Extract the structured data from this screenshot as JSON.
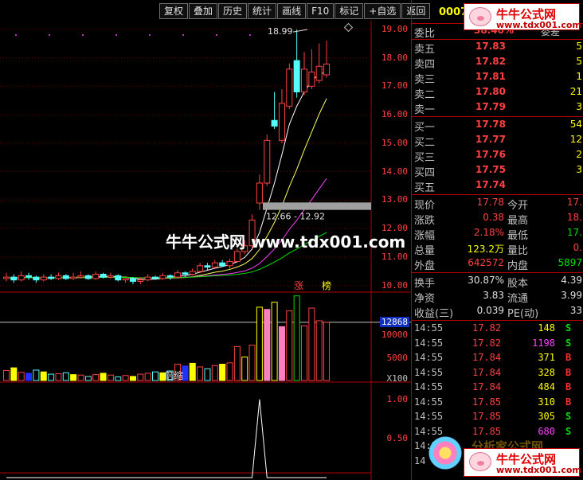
{
  "toolbar": {
    "buttons": [
      "复权",
      "叠加",
      "历史",
      "统计",
      "画线",
      "F10",
      "标记",
      "+自选",
      "返回"
    ]
  },
  "chart": {
    "price_axis": [
      "19.00",
      "18.00",
      "17.00",
      "16.00",
      "15.00",
      "14.00",
      "13.00",
      "12.00",
      "11.00",
      "10.00"
    ],
    "annotations": {
      "high_label": "18.99",
      "gap_label": "12.66 - 12.92",
      "limit_tag_1": "涨",
      "limit_tag_2": "榜"
    },
    "volume_axis": [
      "10000",
      "5000"
    ],
    "volume_current": "12868",
    "volume_unit": "X100",
    "volume_label": "倍缩",
    "indicator_axis": [
      "1.00",
      "0.50"
    ]
  },
  "watermark": {
    "main": "牛牛公式网 www.tdx001.com",
    "logo_title": "牛牛公式网",
    "logo_url": "www.tdx001.com",
    "faded_text": "分析家公式网"
  },
  "panel": {
    "code": "0007",
    "ratio_label": "委比",
    "ratio_value": "38.40%",
    "diff_label": "委差",
    "asks": [
      {
        "label": "卖五",
        "price": "17.83",
        "vol": "5"
      },
      {
        "label": "卖四",
        "price": "17.82",
        "vol": "5"
      },
      {
        "label": "卖三",
        "price": "17.81",
        "vol": "1"
      },
      {
        "label": "卖二",
        "price": "17.80",
        "vol": "21"
      },
      {
        "label": "卖一",
        "price": "17.79",
        "vol": "3"
      }
    ],
    "bids": [
      {
        "label": "买一",
        "price": "17.78",
        "vol": "54"
      },
      {
        "label": "买二",
        "price": "17.77",
        "vol": "12"
      },
      {
        "label": "买三",
        "price": "17.76",
        "vol": "2"
      },
      {
        "label": "买四",
        "price": "17.75",
        "vol": "3"
      },
      {
        "label": "买五",
        "price": "17.74",
        "vol": ""
      }
    ],
    "info": [
      {
        "l1": "现价",
        "v1": "17.78",
        "l2": "今开",
        "v2": "17."
      },
      {
        "l1": "涨跌",
        "v1": "0.38",
        "l2": "最高",
        "v2": "18."
      },
      {
        "l1": "涨幅",
        "v1": "2.18%",
        "l2": "最低",
        "v2": "17."
      },
      {
        "l1": "总量",
        "v1": "123.2万",
        "l2": "量比",
        "v2": "0."
      },
      {
        "l1": "外盘",
        "v1": "642572",
        "l2": "内盘",
        "v2": "5897"
      }
    ],
    "info2": [
      {
        "l1": "换手",
        "v1": "30.87%",
        "l2": "股本",
        "v2": "4.39"
      },
      {
        "l1": "净资",
        "v1": "3.83",
        "l2": "流通",
        "v2": "3.99"
      },
      {
        "l1": "收益(三)",
        "v1": "0.039",
        "l2": "PE(动)",
        "v2": "33"
      }
    ],
    "ticks": [
      {
        "time": "14:55",
        "price": "17.82",
        "vol": "148",
        "side": "S"
      },
      {
        "time": "14:55",
        "price": "17.82",
        "vol": "1198",
        "side": "S"
      },
      {
        "time": "14:55",
        "price": "17.84",
        "vol": "371",
        "side": "B"
      },
      {
        "time": "14:55",
        "price": "17.84",
        "vol": "328",
        "side": "B"
      },
      {
        "time": "14:55",
        "price": "17.84",
        "vol": "484",
        "side": "B"
      },
      {
        "time": "14:55",
        "price": "17.85",
        "vol": "310",
        "side": "B"
      },
      {
        "time": "14:55",
        "price": "17.85",
        "vol": "305",
        "side": "S"
      },
      {
        "time": "14:55",
        "price": "17.85",
        "vol": "680",
        "side": "S"
      },
      {
        "time": "14:55",
        "price": "",
        "vol": "",
        "side": ""
      },
      {
        "time": "14",
        "price": "",
        "vol": "",
        "side": ""
      }
    ]
  },
  "colors": {
    "up": "#ff4040",
    "down": "#54fcfc",
    "buy": "#ff3030",
    "sell": "#00e000",
    "yellow": "#ffff00",
    "magenta": "#ff40ff"
  },
  "chart_data": {
    "type": "candlestick",
    "price_range": [
      9.8,
      19.3
    ],
    "candles": [
      {
        "o": 10.25,
        "c": 10.3,
        "h": 10.45,
        "l": 10.15
      },
      {
        "o": 10.3,
        "c": 10.2,
        "h": 10.4,
        "l": 10.1
      },
      {
        "o": 10.2,
        "c": 10.35,
        "h": 10.5,
        "l": 10.15
      },
      {
        "o": 10.35,
        "c": 10.3,
        "h": 10.45,
        "l": 10.2
      },
      {
        "o": 10.3,
        "c": 10.2,
        "h": 10.35,
        "l": 10.1
      },
      {
        "o": 10.2,
        "c": 10.3,
        "h": 10.4,
        "l": 10.15
      },
      {
        "o": 10.3,
        "c": 10.25,
        "h": 10.4,
        "l": 10.2
      },
      {
        "o": 10.25,
        "c": 10.35,
        "h": 10.45,
        "l": 10.2
      },
      {
        "o": 10.35,
        "c": 10.25,
        "h": 10.4,
        "l": 10.2
      },
      {
        "o": 10.25,
        "c": 10.3,
        "h": 10.45,
        "l": 10.2
      },
      {
        "o": 10.3,
        "c": 10.35,
        "h": 10.5,
        "l": 10.25
      },
      {
        "o": 10.35,
        "c": 10.25,
        "h": 10.4,
        "l": 10.2
      },
      {
        "o": 10.25,
        "c": 10.4,
        "h": 10.5,
        "l": 10.2
      },
      {
        "o": 10.4,
        "c": 10.3,
        "h": 10.45,
        "l": 10.25
      },
      {
        "o": 10.3,
        "c": 10.35,
        "h": 10.45,
        "l": 10.25
      },
      {
        "o": 10.35,
        "c": 10.2,
        "h": 10.4,
        "l": 10.15
      },
      {
        "o": 10.2,
        "c": 10.25,
        "h": 10.3,
        "l": 10.1
      },
      {
        "o": 10.25,
        "c": 10.15,
        "h": 10.3,
        "l": 10.05
      },
      {
        "o": 10.15,
        "c": 10.2,
        "h": 10.3,
        "l": 10.05
      },
      {
        "o": 10.2,
        "c": 10.3,
        "h": 10.4,
        "l": 10.15
      },
      {
        "o": 10.3,
        "c": 10.25,
        "h": 10.35,
        "l": 10.2
      },
      {
        "o": 10.25,
        "c": 10.35,
        "h": 10.45,
        "l": 10.2
      },
      {
        "o": 10.35,
        "c": 10.3,
        "h": 10.4,
        "l": 10.2
      },
      {
        "o": 10.3,
        "c": 10.45,
        "h": 10.55,
        "l": 10.25
      },
      {
        "o": 10.45,
        "c": 10.4,
        "h": 10.5,
        "l": 10.3
      },
      {
        "o": 10.4,
        "c": 10.5,
        "h": 10.6,
        "l": 10.35
      },
      {
        "o": 10.5,
        "c": 10.7,
        "h": 10.8,
        "l": 10.45
      },
      {
        "o": 10.7,
        "c": 10.65,
        "h": 10.8,
        "l": 10.55
      },
      {
        "o": 10.65,
        "c": 10.8,
        "h": 10.9,
        "l": 10.6
      },
      {
        "o": 10.8,
        "c": 10.7,
        "h": 10.9,
        "l": 10.65
      },
      {
        "o": 10.7,
        "c": 10.85,
        "h": 10.95,
        "l": 10.6
      },
      {
        "o": 10.85,
        "c": 11.2,
        "h": 11.3,
        "l": 10.8
      },
      {
        "o": 11.2,
        "c": 11.4,
        "h": 11.6,
        "l": 11.1
      },
      {
        "o": 11.4,
        "c": 12.3,
        "h": 12.5,
        "l": 11.3
      },
      {
        "o": 12.9,
        "c": 13.6,
        "h": 13.9,
        "l": 12.66
      },
      {
        "o": 13.6,
        "c": 15.1,
        "h": 15.3,
        "l": 13.5
      },
      {
        "o": 15.8,
        "c": 15.6,
        "h": 16.8,
        "l": 15.5
      },
      {
        "o": 15.1,
        "c": 16.4,
        "h": 16.9,
        "l": 15.0
      },
      {
        "o": 16.3,
        "c": 17.6,
        "h": 17.8,
        "l": 16.2
      },
      {
        "o": 17.9,
        "c": 16.8,
        "h": 18.99,
        "l": 16.6
      },
      {
        "o": 16.8,
        "c": 17.6,
        "h": 18.2,
        "l": 16.7
      },
      {
        "o": 17.0,
        "c": 17.5,
        "h": 18.3,
        "l": 16.9
      },
      {
        "o": 17.2,
        "c": 17.7,
        "h": 18.5,
        "l": 17.1
      },
      {
        "o": 17.4,
        "c": 17.78,
        "h": 18.6,
        "l": 17.3
      }
    ],
    "volume_range": [
      0,
      19000
    ],
    "volumes": [
      2200,
      2800,
      1800,
      1600,
      2300,
      1900,
      1400,
      1500,
      1700,
      1300,
      1200,
      900,
      1300,
      1600,
      1200,
      800,
      1100,
      900,
      1400,
      1600,
      1900,
      1700,
      2100,
      3600,
      3200,
      3800,
      3000,
      2600,
      3300,
      3600,
      3900,
      7500,
      5200,
      7800,
      16200,
      15700,
      17300,
      11900,
      15400,
      18700,
      12100,
      16000,
      13200,
      12868
    ],
    "indicator_range": [
      0,
      1.2
    ],
    "indicator": [
      0,
      0,
      0,
      0,
      0,
      0,
      0,
      0,
      0,
      0,
      0,
      0,
      0,
      0,
      0,
      0,
      0,
      0,
      0,
      0,
      0,
      0,
      0,
      0,
      0,
      0,
      0,
      0,
      0,
      0,
      0,
      0,
      0,
      0,
      1.0,
      0,
      0,
      0,
      0,
      0,
      0,
      0,
      0,
      0
    ]
  }
}
